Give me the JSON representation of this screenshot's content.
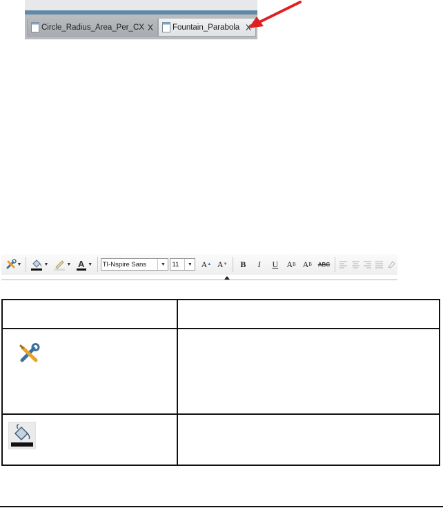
{
  "doc_tabs": [
    {
      "label": "Circle_Radius_Area_Per_CX",
      "close": "X",
      "active": false
    },
    {
      "label": "Fountain_Parabola",
      "close": "X",
      "active": true
    }
  ],
  "toolbar": {
    "font_name": "TI-Nspire Sans",
    "font_size": "11",
    "increase_font": "A",
    "decrease_font": "A",
    "bold": "B",
    "italic": "I",
    "underline": "U",
    "superscript": "A",
    "superscript_mark": "B",
    "subscript": "A",
    "subscript_mark": "B",
    "strikethrough": "ABC"
  },
  "colors": {
    "tab_accent": "#5f8aa6",
    "arrow": "#e02020",
    "fill_bar": "#111111"
  }
}
